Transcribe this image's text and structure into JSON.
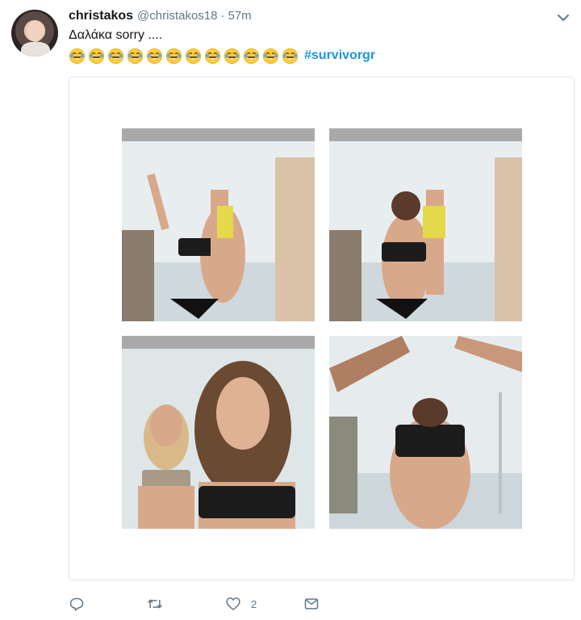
{
  "tweet": {
    "display_name": "christakos",
    "handle": "@christakos18",
    "separator": "·",
    "time": "57m",
    "text": "Δαλάκα sorry ....",
    "emoji_name": "face-with-tears-of-joy",
    "emoji_count": 12,
    "hashtag": "#survivorgr"
  },
  "media": {
    "panels": [
      {
        "name": "photo-panel-1"
      },
      {
        "name": "photo-panel-2"
      },
      {
        "name": "photo-panel-3"
      },
      {
        "name": "photo-panel-4"
      }
    ]
  },
  "actions": {
    "reply_icon": "reply-icon",
    "retweet_icon": "retweet-icon",
    "like_icon": "heart-icon",
    "like_count": "2",
    "message_icon": "envelope-icon"
  },
  "colors": {
    "name": "#14171a",
    "secondary": "#657786",
    "hashtag": "#1b95e0",
    "card_border": "#e1e8ed",
    "panel_bar": "#a9a9a9"
  }
}
